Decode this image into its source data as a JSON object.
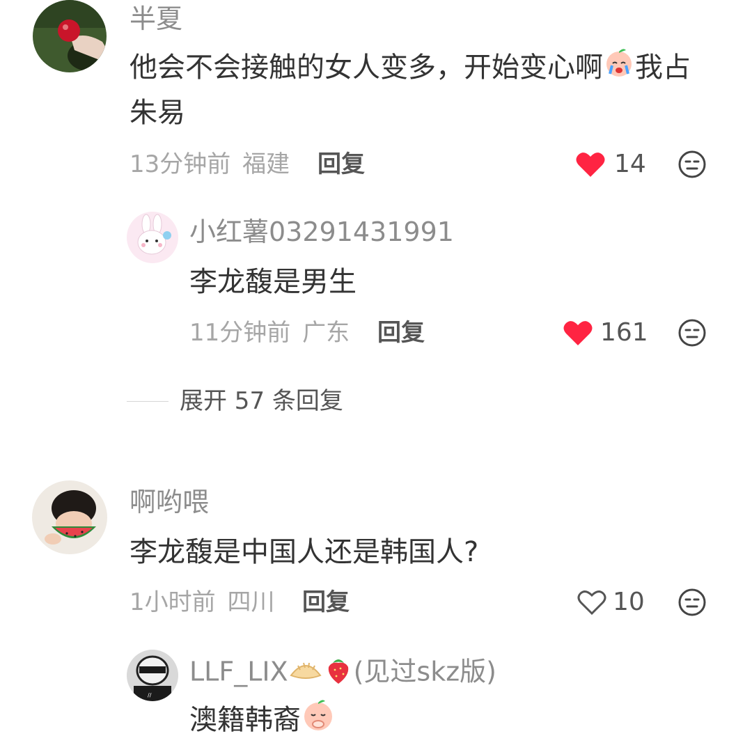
{
  "comments": [
    {
      "username": "半夏",
      "text_main": "他会不会接触的女人变多，开始变心啊",
      "text_tail_1": "我占",
      "text_tail_2": "朱易",
      "time": "13分钟前",
      "location": "福建",
      "reply_label": "回复",
      "likes": "14",
      "liked": true,
      "avatar_icon": "apple-in-hand-avatar",
      "reply": {
        "username": "小红薯03291431991",
        "text": "李龙馥是男生",
        "time": "11分钟前",
        "location": "广东",
        "reply_label": "回复",
        "likes": "161",
        "liked": true,
        "avatar_icon": "bunny-avatar"
      },
      "expand_label": "展开 57 条回复"
    },
    {
      "username": "啊哟喂",
      "text": "李龙馥是中国人还是韩国人?",
      "time": "1小时前",
      "location": "四川",
      "reply_label": "回复",
      "likes": "10",
      "liked": false,
      "avatar_icon": "child-eating-watermelon-avatar",
      "reply": {
        "username_main": "LLF_LIX",
        "username_tail": "(见过skz版)",
        "text": "澳籍韩裔",
        "avatar_icon": "masked-person-avatar"
      }
    }
  ],
  "colors": {
    "like_red": "#ff2442",
    "text": "#333333",
    "muted": "#a6a6a6"
  }
}
